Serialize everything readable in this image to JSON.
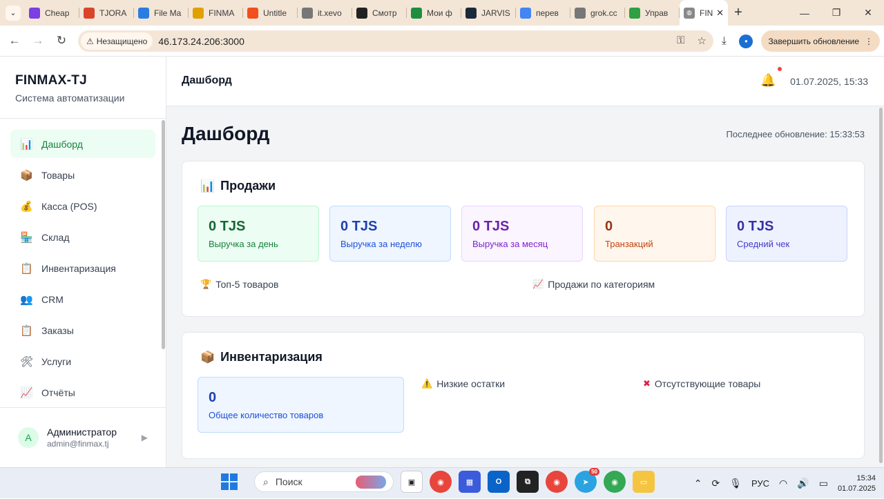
{
  "browser": {
    "tabs": [
      {
        "title": "Cheap",
        "icon": "purple-square-icon",
        "color": "#7b3fe4"
      },
      {
        "title": "TJORA",
        "icon": "red-puzzle-icon",
        "color": "#d9452b"
      },
      {
        "title": "File Ma",
        "icon": "s-logo-icon",
        "color": "#2a7de1"
      },
      {
        "title": "FINMA",
        "icon": "finmax-icon",
        "color": "#e0a100"
      },
      {
        "title": "Untitle",
        "icon": "figma-icon",
        "color": "#f24e1e"
      },
      {
        "title": "it.xevo",
        "icon": "globe-icon",
        "color": "#777777"
      },
      {
        "title": "Смотр",
        "icon": "hd-icon",
        "color": "#222222"
      },
      {
        "title": "Мои ф",
        "icon": "sheets-plus-icon",
        "color": "#1e8e3e"
      },
      {
        "title": "JARVIS",
        "icon": "jarvis-icon",
        "color": "#1b2a3a"
      },
      {
        "title": "перев",
        "icon": "google-icon",
        "color": "#4285f4"
      },
      {
        "title": "grok.cc",
        "icon": "globe-icon",
        "color": "#777777"
      },
      {
        "title": "Управ",
        "icon": "leaf-icon",
        "color": "#2ea043"
      }
    ],
    "active_tab": {
      "title": "FIN",
      "icon": "globe-icon"
    },
    "insecure_label": "Незащищено",
    "url": "46.173.24.206:3000",
    "update_button": "Завершить обновление"
  },
  "sidebar": {
    "brand_title": "FINMAX-TJ",
    "brand_subtitle": "Система автоматизации",
    "items": [
      {
        "label": "Дашборд",
        "icon": "📊"
      },
      {
        "label": "Товары",
        "icon": "📦"
      },
      {
        "label": "Касса (POS)",
        "icon": "💰"
      },
      {
        "label": "Склад",
        "icon": "🏪"
      },
      {
        "label": "Инвентаризация",
        "icon": "📋"
      },
      {
        "label": "CRM",
        "icon": "👥"
      },
      {
        "label": "Заказы",
        "icon": "📋"
      },
      {
        "label": "Услуги",
        "icon": "🛠"
      },
      {
        "label": "Отчёты",
        "icon": "📈"
      }
    ],
    "user": {
      "initial": "A",
      "name": "Администратор",
      "email": "admin@finmax.tj"
    }
  },
  "topbar": {
    "title": "Дашборд",
    "datetime": "01.07.2025, 15:33"
  },
  "main": {
    "page_title": "Дашборд",
    "last_update": "Последнее обновление: 15:33:53",
    "sales": {
      "title": "Продажи",
      "stats": [
        {
          "value": "0 TJS",
          "label": "Выручка за день"
        },
        {
          "value": "0 TJS",
          "label": "Выручка за неделю"
        },
        {
          "value": "0 TJS",
          "label": "Выручка за месяц"
        },
        {
          "value": "0",
          "label": "Транзакций"
        },
        {
          "value": "0 TJS",
          "label": "Средний чек"
        }
      ],
      "top5_title": "Топ-5 товаров",
      "categories_title": "Продажи по категориям"
    },
    "inventory": {
      "title": "Инвентаризация",
      "total_value": "0",
      "total_label": "Общее количество товаров",
      "low_stock_title": "Низкие остатки",
      "missing_title": "Отсутствующие товары"
    }
  },
  "taskbar": {
    "search_placeholder": "Поиск",
    "telegram_badge": "50",
    "language": "РУС",
    "time": "15:34",
    "date": "01.07.2025"
  }
}
